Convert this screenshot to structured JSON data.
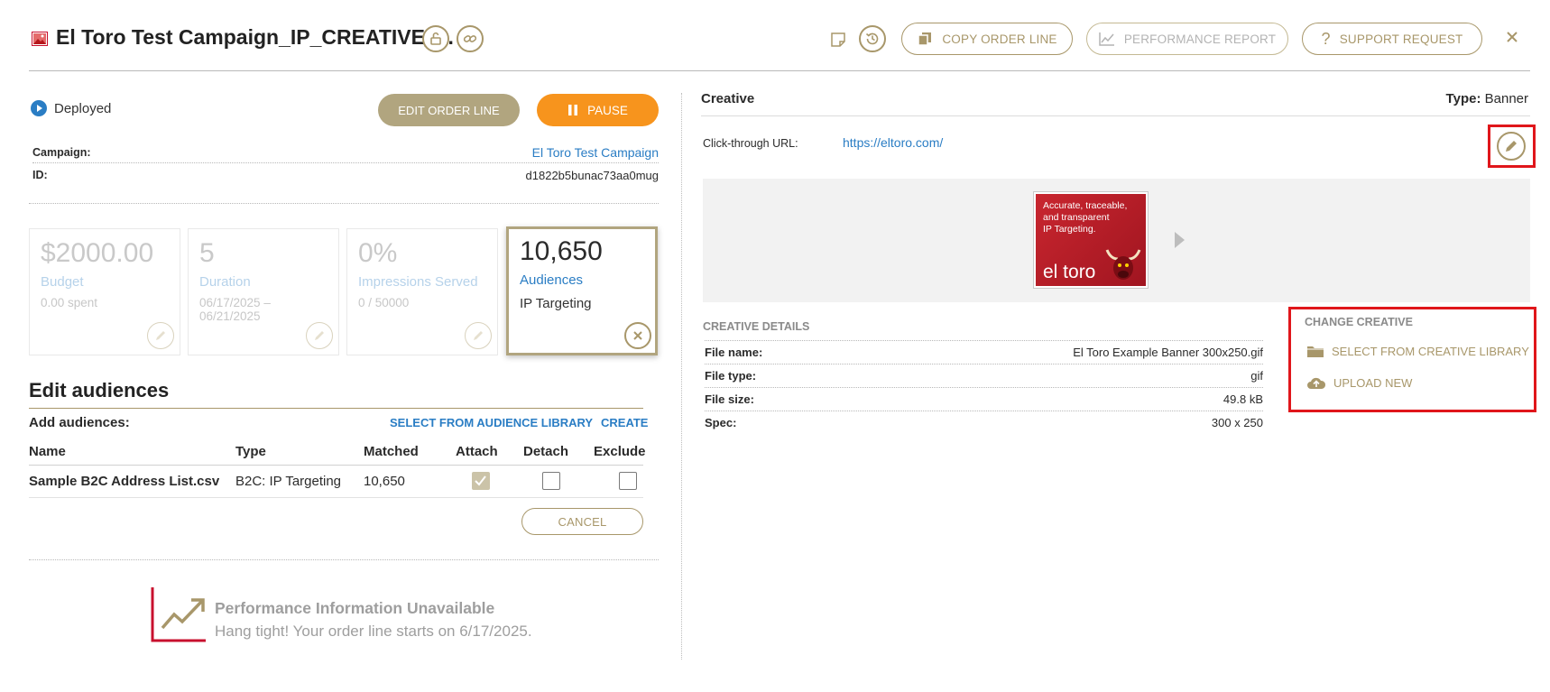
{
  "header": {
    "title": "El Toro Test Campaign_IP_CREATIVE_...",
    "buttons": {
      "copy": "COPY ORDER LINE",
      "performance": "PERFORMANCE REPORT",
      "support": "SUPPORT REQUEST"
    }
  },
  "status": {
    "label": "Deployed",
    "edit_button": "EDIT ORDER LINE",
    "pause_button": "PAUSE"
  },
  "info": {
    "campaign_label": "Campaign:",
    "campaign_value": "El Toro Test Campaign",
    "id_label": "ID:",
    "id_value": "d1822b5bunac73aa0mug"
  },
  "cards": {
    "budget": {
      "value": "$2000.00",
      "label": "Budget",
      "sub": "0.00 spent"
    },
    "duration": {
      "value": "5",
      "label": "Duration",
      "sub1": "06/17/2025 –",
      "sub2": "06/21/2025"
    },
    "impressions": {
      "value": "0%",
      "label": "Impressions Served",
      "sub": "0 / 50000"
    },
    "audiences": {
      "value": "10,650",
      "label": "Audiences",
      "sub": "IP Targeting"
    }
  },
  "edit_audiences": {
    "title": "Edit audiences",
    "add_label": "Add audiences:",
    "select_library": "SELECT FROM AUDIENCE LIBRARY",
    "create": "CREATE",
    "columns": [
      "Name",
      "Type",
      "Matched",
      "Attach",
      "Detach",
      "Exclude"
    ],
    "row": {
      "name": "Sample B2C Address List.csv",
      "type": "B2C: IP Targeting",
      "matched": "10,650"
    },
    "cancel": "CANCEL"
  },
  "performance": {
    "title": "Performance Information Unavailable",
    "message": "Hang tight! Your order line starts on 6/17/2025."
  },
  "creative": {
    "heading": "Creative",
    "type_label": "Type:",
    "type_value": "Banner",
    "click_label": "Click-through URL:",
    "click_url": "https://eltoro.com/",
    "banner_text": [
      "Accurate, traceable,",
      "and transparent",
      "IP Targeting."
    ],
    "banner_brand": "el toro",
    "details_heading": "CREATIVE DETAILS",
    "details": [
      {
        "label": "File name:",
        "value": "El Toro Example Banner 300x250.gif"
      },
      {
        "label": "File type:",
        "value": "gif"
      },
      {
        "label": "File size:",
        "value": "49.8 kB"
      },
      {
        "label": "Spec:",
        "value": "300 x 250"
      }
    ],
    "change_heading": "CHANGE CREATIVE",
    "select_library": "SELECT FROM CREATIVE LIBRARY",
    "upload": "UPLOAD NEW"
  },
  "colors": {
    "gold": "#a8976a",
    "orange": "#f7941d",
    "blue": "#2a7dc4",
    "highlight_red": "#e0161b",
    "performance_red": "#c8102e"
  }
}
